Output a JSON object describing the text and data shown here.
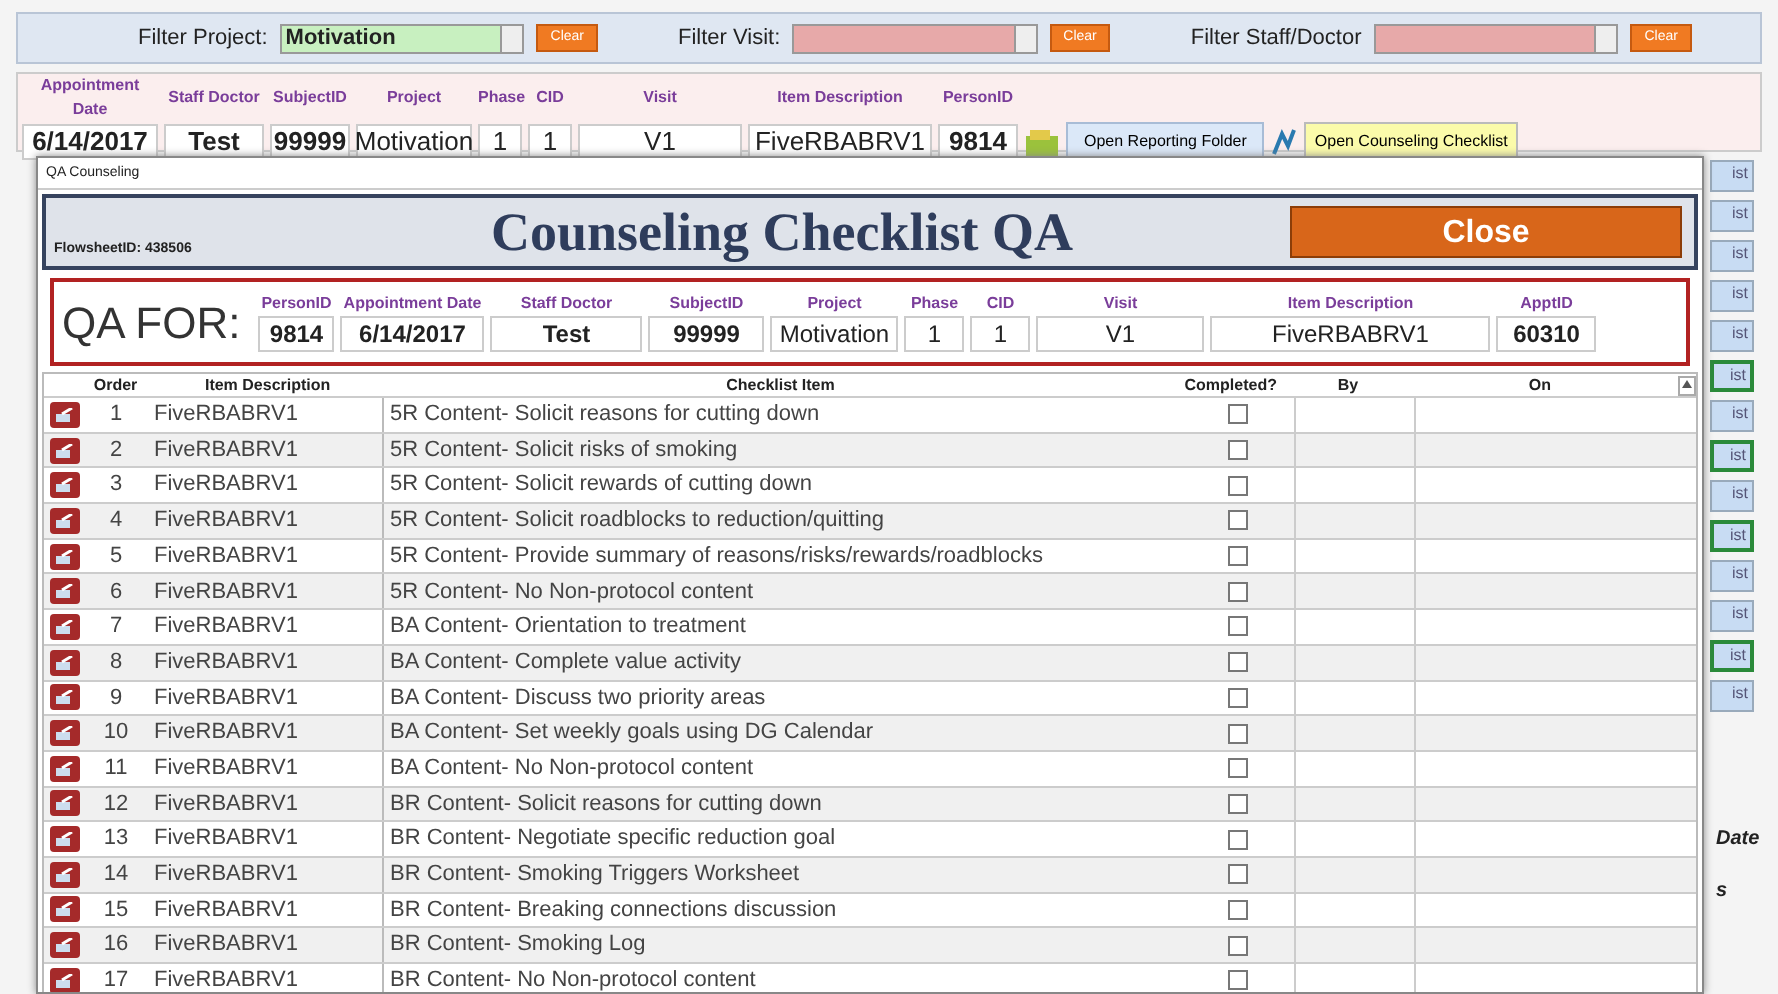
{
  "filters": [
    {
      "label": "Filter Project:",
      "value": "Motivation",
      "filled": true,
      "clear": "Clear"
    },
    {
      "label": "Filter Visit:",
      "filled": false,
      "clear": "Clear"
    },
    {
      "label": "Filter Staff/Doctor",
      "filled": false,
      "clear": "Clear"
    }
  ],
  "record": {
    "columns": [
      "Appointment Date",
      "Staff Doctor",
      "SubjectID",
      "Project",
      "Phase",
      "CID",
      "Visit",
      "Item Description",
      "PersonID"
    ],
    "values": [
      "6/14/2017",
      "Test",
      "99999",
      "Motivation",
      "1",
      "1",
      "V1",
      "FiveRBABRV1",
      "9814"
    ],
    "reporting_button": "Open Reporting Folder",
    "checklist_button": "Open Counseling Checklist"
  },
  "background_buttons": [
    {
      "label": "ist",
      "outlined": false
    },
    {
      "label": "ist",
      "outlined": false
    },
    {
      "label": "ist",
      "outlined": false
    },
    {
      "label": "ist",
      "outlined": false
    },
    {
      "label": "ist",
      "outlined": false
    },
    {
      "label": "ist",
      "outlined": true
    },
    {
      "label": "ist",
      "outlined": false
    },
    {
      "label": "ist",
      "outlined": true
    },
    {
      "label": "ist",
      "outlined": false
    },
    {
      "label": "ist",
      "outlined": true
    },
    {
      "label": "ist",
      "outlined": false
    },
    {
      "label": "ist",
      "outlined": false
    },
    {
      "label": "ist",
      "outlined": true
    },
    {
      "label": "ist",
      "outlined": false
    }
  ],
  "background_texts": [
    "Date",
    "s"
  ],
  "dialog": {
    "title": "QA Counseling",
    "flowsheet_label": "FlowsheetID:",
    "flowsheet_id": "438506",
    "heading": "Counseling Checklist QA",
    "close": "Close",
    "qa_for": {
      "label": "QA FOR:",
      "columns": [
        "PersonID",
        "Appointment Date",
        "Staff Doctor",
        "SubjectID",
        "Project",
        "Phase",
        "CID",
        "Visit",
        "Item Description",
        "ApptID"
      ],
      "values": [
        "9814",
        "6/14/2017",
        "Test",
        "99999",
        "Motivation",
        "1",
        "1",
        "V1",
        "FiveRBABRV1",
        "60310"
      ]
    },
    "grid": {
      "columns": [
        "Order",
        "Item Description",
        "Checklist Item",
        "Completed?",
        "By",
        "On"
      ],
      "rows": [
        {
          "order": "1",
          "item": "FiveRBABRV1",
          "checklist": "5R Content- Solicit reasons for cutting down",
          "completed": false
        },
        {
          "order": "2",
          "item": "FiveRBABRV1",
          "checklist": "5R Content- Solicit risks of smoking",
          "completed": false
        },
        {
          "order": "3",
          "item": "FiveRBABRV1",
          "checklist": "5R Content- Solicit rewards of cutting down",
          "completed": false
        },
        {
          "order": "4",
          "item": "FiveRBABRV1",
          "checklist": "5R Content- Solicit roadblocks to reduction/quitting",
          "completed": false
        },
        {
          "order": "5",
          "item": "FiveRBABRV1",
          "checklist": "5R Content- Provide summary of reasons/risks/rewards/roadblocks",
          "completed": false
        },
        {
          "order": "6",
          "item": "FiveRBABRV1",
          "checklist": "5R Content- No Non-protocol content",
          "completed": false
        },
        {
          "order": "7",
          "item": "FiveRBABRV1",
          "checklist": "BA Content- Orientation to treatment",
          "completed": false
        },
        {
          "order": "8",
          "item": "FiveRBABRV1",
          "checklist": "BA Content- Complete value activity",
          "completed": false
        },
        {
          "order": "9",
          "item": "FiveRBABRV1",
          "checklist": "BA Content- Discuss two priority areas",
          "completed": false
        },
        {
          "order": "10",
          "item": "FiveRBABRV1",
          "checklist": "BA Content- Set weekly goals using DG Calendar",
          "completed": false
        },
        {
          "order": "11",
          "item": "FiveRBABRV1",
          "checklist": "BA Content- No Non-protocol content",
          "completed": false
        },
        {
          "order": "12",
          "item": "FiveRBABRV1",
          "checklist": "BR Content- Solicit reasons for cutting down",
          "completed": false
        },
        {
          "order": "13",
          "item": "FiveRBABRV1",
          "checklist": "BR Content- Negotiate specific reduction goal",
          "completed": false
        },
        {
          "order": "14",
          "item": "FiveRBABRV1",
          "checklist": "BR Content- Smoking Triggers Worksheet",
          "completed": false
        },
        {
          "order": "15",
          "item": "FiveRBABRV1",
          "checklist": "BR Content- Breaking connections discussion",
          "completed": false
        },
        {
          "order": "16",
          "item": "FiveRBABRV1",
          "checklist": "BR Content- Smoking Log",
          "completed": false
        },
        {
          "order": "17",
          "item": "FiveRBABRV1",
          "checklist": "BR Content- No Non-protocol content",
          "completed": false
        }
      ]
    }
  }
}
